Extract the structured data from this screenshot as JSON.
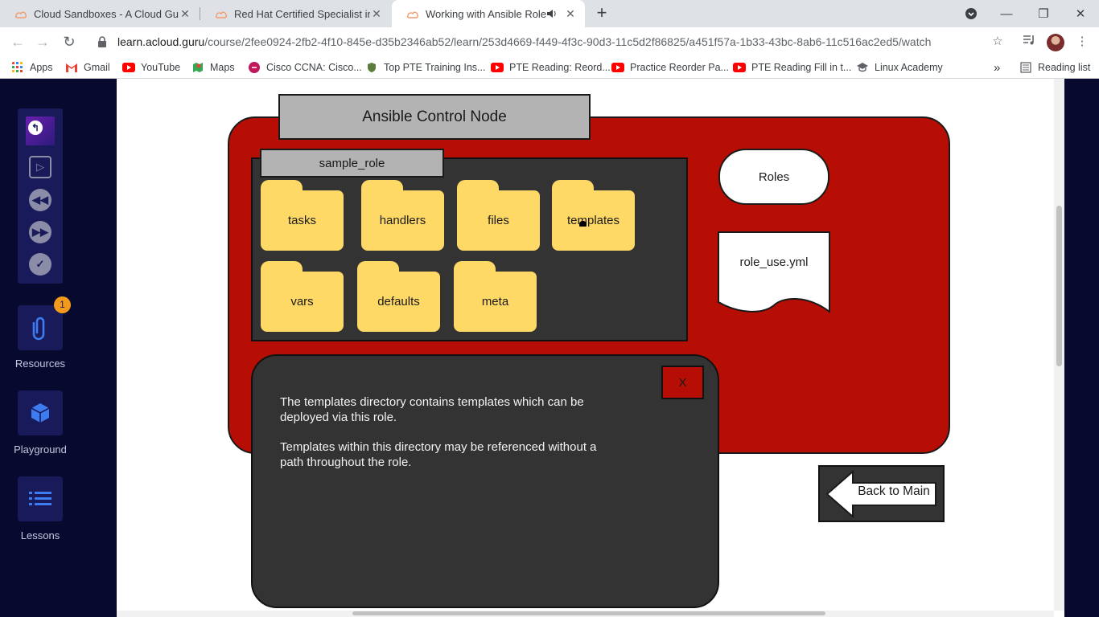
{
  "browser": {
    "tabs": [
      {
        "title": "Cloud Sandboxes - A Cloud Guru",
        "close": "✕",
        "active": false
      },
      {
        "title": "Red Hat Certified Specialist in An",
        "close": "✕",
        "active": false
      },
      {
        "title": "Working with Ansible Roles",
        "close": "✕",
        "active": true
      }
    ],
    "new_tab": "+",
    "window_controls": {
      "minimize": "—",
      "maximize": "❐",
      "close": "✕"
    },
    "url": {
      "host": "learn.acloud.guru",
      "path": "/course/2fee0924-2fb2-4f10-845e-d35b2346ab52/learn/253d4669-f449-4f3c-90d3-11c5d2f86825/a451f57a-1b33-43bc-8ab6-11c516ac2ed5/watch"
    },
    "bookmarks": [
      {
        "label": "Apps",
        "icon": "apps-grid-icon"
      },
      {
        "label": "Gmail",
        "icon": "gmail-icon"
      },
      {
        "label": "YouTube",
        "icon": "youtube-icon"
      },
      {
        "label": "Maps",
        "icon": "maps-icon"
      },
      {
        "label": "Cisco CCNA: Cisco...",
        "icon": "cisco-icon"
      },
      {
        "label": "Top PTE Training Ins...",
        "icon": "shield-icon"
      },
      {
        "label": "PTE Reading: Reord...",
        "icon": "youtube-icon"
      },
      {
        "label": "Practice Reorder Pa...",
        "icon": "youtube-icon"
      },
      {
        "label": "PTE Reading Fill in t...",
        "icon": "youtube-icon"
      },
      {
        "label": "Linux Academy",
        "icon": "graduation-cap-icon"
      }
    ],
    "bookmarks_overflow": "»",
    "reading_list": "Reading list"
  },
  "sidebar": {
    "resources": {
      "label": "Resources",
      "badge": "1"
    },
    "playground": {
      "label": "Playground"
    },
    "lessons": {
      "label": "Lessons"
    }
  },
  "diagram": {
    "control_node": "Ansible Control Node",
    "role_name": "sample_role",
    "folders": [
      "tasks",
      "handlers",
      "files",
      "templates",
      "vars",
      "defaults",
      "meta"
    ],
    "roles": "Roles",
    "role_file": "role_use.yml",
    "popup": {
      "close": "X",
      "paragraph1": "The templates directory contains templates which can be deployed via this role.",
      "paragraph2": "Templates within this directory may be referenced without a path throughout the role."
    },
    "back_button": "Back to Main"
  },
  "colors": {
    "red": "#b60e04",
    "folder_yellow": "#ffd966",
    "dark_panel": "#333333",
    "sidebar_navy": "#070a2e",
    "tile_navy": "#181a5a",
    "badge_orange": "#f39a1d"
  }
}
